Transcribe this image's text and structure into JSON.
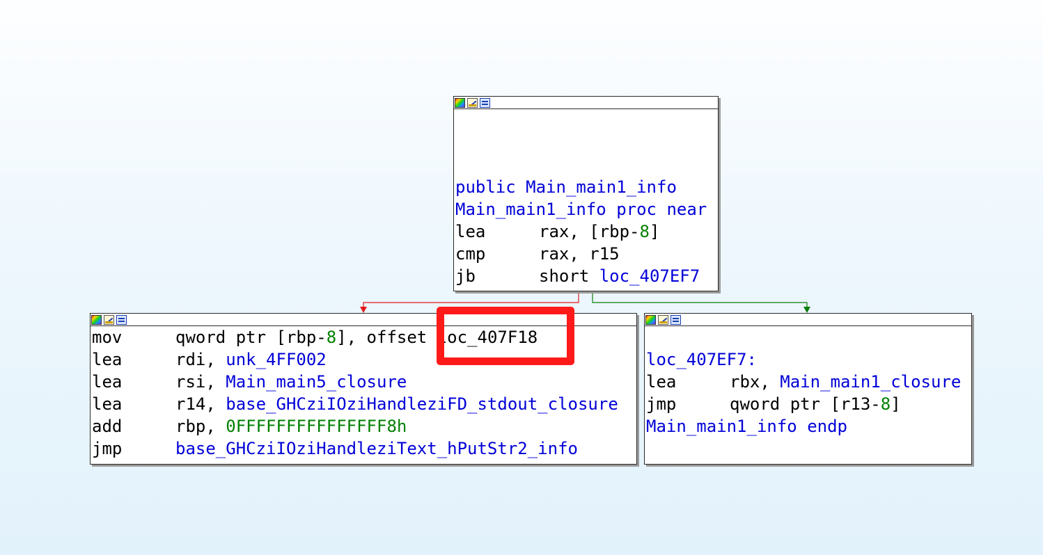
{
  "top_block": {
    "lines": [
      {
        "kw": "public",
        "sym": "Main_main1_info"
      },
      {
        "label": "Main_main1_info",
        "kw": "proc near"
      }
    ],
    "ins": [
      {
        "mn": "lea",
        "a": "rax, [rbp-",
        "b": "8",
        "c": "]"
      },
      {
        "mn": "cmp",
        "a": "rax, r15"
      },
      {
        "mn": "jb",
        "a": "short ",
        "sym": "loc_407EF7"
      }
    ]
  },
  "left_block": {
    "ins": [
      {
        "mn": "mov",
        "a": "qword ptr [rbp-",
        "b": "8",
        "c": "], offset ",
        "sym": "loc_407F18"
      },
      {
        "mn": "lea",
        "a": "rdi, ",
        "sym": "unk_4FF002"
      },
      {
        "mn": "lea",
        "a": "rsi, ",
        "sym": "Main_main5_closure"
      },
      {
        "mn": "lea",
        "a": "r14, ",
        "sym": "base_GHCziIOziHandleziFD_stdout_closure"
      },
      {
        "mn": "add",
        "a": "rbp, ",
        "num": "0FFFFFFFFFFFFFFF8h"
      },
      {
        "mn": "jmp",
        "a": "",
        "sym": "base_GHCziIOziHandleziText_hPutStr2_info"
      }
    ]
  },
  "right_block": {
    "label": "loc_407EF7:",
    "ins": [
      {
        "mn": "lea",
        "a": "rbx, ",
        "sym": "Main_main1_closure"
      },
      {
        "mn": "jmp",
        "a": "qword ptr [r13-",
        "b": "8",
        "c": "]"
      }
    ],
    "end_label": "Main_main1_info",
    "end_kw": "endp"
  },
  "colors": {
    "symbol": "#0000d8",
    "number": "#008000",
    "edge_false": "#e31b1b",
    "edge_true": "#0a7d0a",
    "highlight": "#ff1a1a"
  },
  "icons": [
    "color-palette-icon",
    "edit-pencil-icon",
    "graph-view-icon"
  ]
}
